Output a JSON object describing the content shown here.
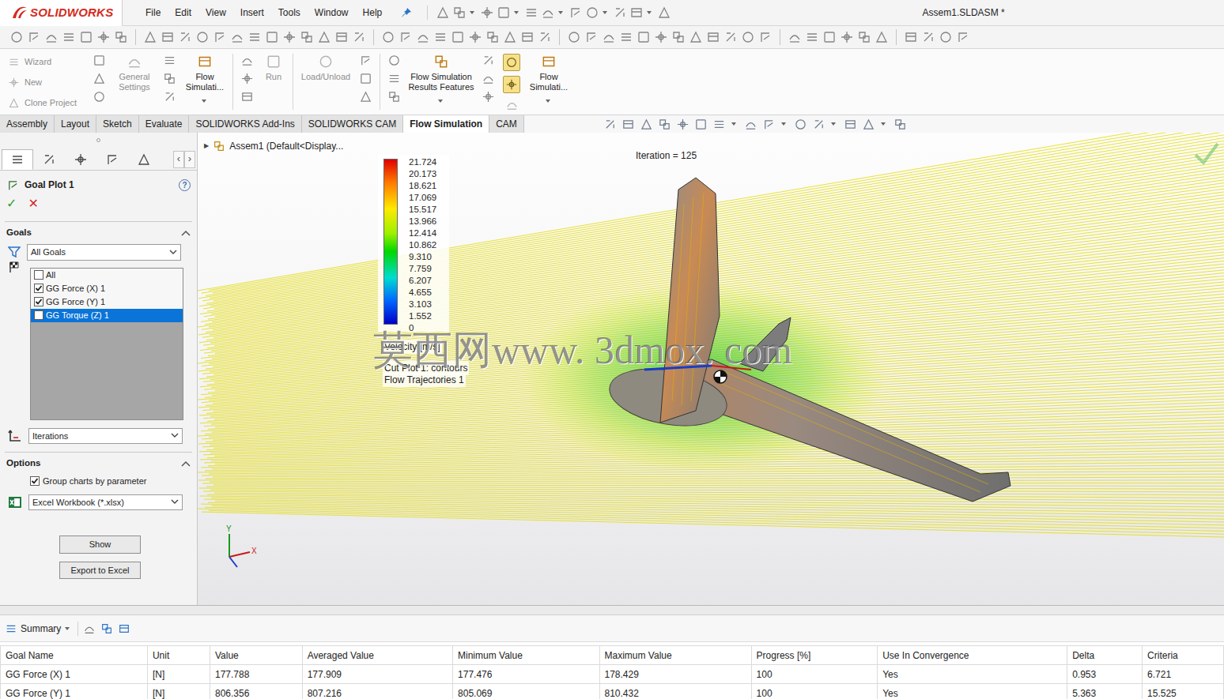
{
  "window": {
    "title": "Assem1.SLDASM *",
    "app": "SOLIDWORKS"
  },
  "menu": [
    "File",
    "Edit",
    "View",
    "Insert",
    "Tools",
    "Window",
    "Help"
  ],
  "ribbon": [
    {
      "kind": "stack",
      "items": [
        {
          "label": "Wizard",
          "disabled": true
        },
        {
          "label": "New",
          "disabled": true
        },
        {
          "label": "Clone Project",
          "disabled": true
        }
      ]
    },
    {
      "kind": "large",
      "label": "General Settings",
      "disabled": true,
      "dropdown": false
    },
    {
      "kind": "large",
      "label": "Flow Simulati...",
      "disabled": false,
      "dropdown": true
    },
    {
      "kind": "large",
      "label": "Run",
      "disabled": true,
      "dropdown": false
    },
    {
      "kind": "large",
      "label": "Load/Unload",
      "disabled": true,
      "dropdown": false
    },
    {
      "kind": "large",
      "label": "Flow Simulation Results Features",
      "disabled": false,
      "dropdown": true
    },
    {
      "kind": "toggles",
      "items": [
        {
          "selected": true
        },
        {
          "selected": true
        }
      ]
    },
    {
      "kind": "large",
      "label": "Flow Simulati...",
      "disabled": false,
      "dropdown": true
    }
  ],
  "tabs": [
    {
      "label": "Assembly",
      "selected": false
    },
    {
      "label": "Layout",
      "selected": false
    },
    {
      "label": "Sketch",
      "selected": false
    },
    {
      "label": "Evaluate",
      "selected": false
    },
    {
      "label": "SOLIDWORKS Add-Ins",
      "selected": false
    },
    {
      "label": "SOLIDWORKS CAM",
      "selected": false
    },
    {
      "label": "Flow Simulation",
      "selected": true
    },
    {
      "label": "CAM",
      "selected": false
    }
  ],
  "property_manager": {
    "tabs": [
      {
        "selected": true
      },
      {
        "selected": false
      },
      {
        "selected": false
      },
      {
        "selected": false
      },
      {
        "selected": false
      }
    ],
    "scroll": [
      "‹",
      "›"
    ],
    "title": "Goal Plot 1",
    "help": "?",
    "ok": "✓",
    "cancel": "✕",
    "goals": {
      "header": "Goals",
      "filter": "All Goals",
      "items": [
        {
          "label": "All",
          "checked": false,
          "selected": false
        },
        {
          "label": "GG Force (X) 1",
          "checked": true,
          "selected": false
        },
        {
          "label": "GG Force (Y) 1",
          "checked": true,
          "selected": false
        },
        {
          "label": "GG Torque (Z) 1",
          "checked": false,
          "selected": true
        }
      ]
    },
    "x_axis": "Iterations",
    "options": {
      "header": "Options",
      "group_charts": {
        "label": "Group charts by parameter",
        "checked": true
      },
      "format": "Excel Workbook (*.xlsx)"
    },
    "buttons": [
      "Show",
      "Export to Excel"
    ]
  },
  "viewport": {
    "tree": {
      "expand": "▶",
      "label": "Assem1 (Default<Display..."
    },
    "iteration": "Iteration = 125",
    "legend": {
      "values": [
        "21.724",
        "20.173",
        "18.621",
        "17.069",
        "15.517",
        "13.966",
        "12.414",
        "10.862",
        "9.310",
        "7.759",
        "6.207",
        "4.655",
        "3.103",
        "1.552",
        "0"
      ],
      "title": "Velocity [m/s]"
    },
    "plots": [
      "Cut Plot 1: contours",
      "Flow Trajectories 1"
    ],
    "watermark": "莫西网www. 3dmox. com",
    "triad": [
      "Y",
      "X"
    ]
  },
  "results": {
    "view": "Summary",
    "columns": [
      "Goal Name",
      "Unit",
      "Value",
      "Averaged Value",
      "Minimum Value",
      "Maximum Value",
      "Progress [%]",
      "Use In Convergence",
      "Delta",
      "Criteria"
    ],
    "rows": [
      [
        "GG Force (X) 1",
        "[N]",
        "177.788",
        "177.909",
        "177.476",
        "178.429",
        "100",
        "Yes",
        "0.953",
        "6.721"
      ],
      [
        "GG Force (Y) 1",
        "[N]",
        "806.356",
        "807.216",
        "805.069",
        "810.432",
        "100",
        "Yes",
        "5.363",
        "15.525"
      ]
    ]
  }
}
